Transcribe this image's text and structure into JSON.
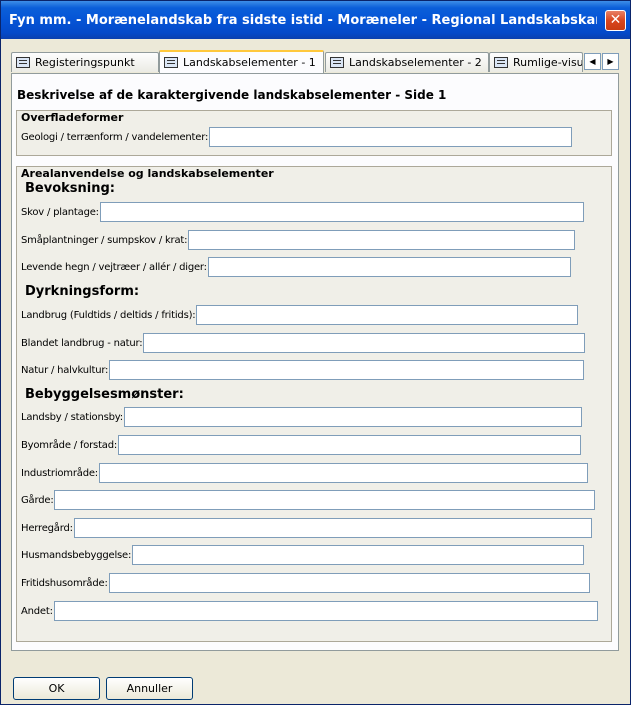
{
  "window": {
    "title": "Fyn mm. - Morænelandskab fra sidste istid - Moræneler - Regional Landskabskara...",
    "close_glyph": "✕"
  },
  "tabs": [
    {
      "label": "Registeringspunkt",
      "icon": "form-icon"
    },
    {
      "label": "Landskabselementer - 1",
      "icon": "form-icon",
      "active": true
    },
    {
      "label": "Landskabselementer - 2",
      "icon": "form-icon"
    },
    {
      "label": "Rumlige-visue",
      "icon": "form-icon"
    }
  ],
  "tab_scroll": {
    "left": "◀",
    "right": "▶"
  },
  "page": {
    "heading": "Beskrivelse af de karaktergivende landskabselementer - Side 1"
  },
  "overfladeformer": {
    "title": "Overfladeformer",
    "fields": [
      {
        "label": "Geologi / terrænform / vandelementer:",
        "value": ""
      }
    ]
  },
  "arealanvendelse": {
    "title": "Arealanvendelse og landskabselementer",
    "bevoksning": {
      "heading": "Bevoksning:",
      "fields": [
        {
          "label": "Skov / plantage:",
          "value": ""
        },
        {
          "label": "Småplantninger / sumpskov / krat:",
          "value": ""
        },
        {
          "label": "Levende hegn / vejtræer / allér / diger:",
          "value": ""
        }
      ]
    },
    "dyrkningsform": {
      "heading": "Dyrkningsform:",
      "fields": [
        {
          "label": "Landbrug (Fuldtids / deltids / fritids):",
          "value": ""
        },
        {
          "label": "Blandet landbrug - natur:",
          "value": ""
        },
        {
          "label": "Natur / halvkultur:",
          "value": ""
        }
      ]
    },
    "bebyggelse": {
      "heading": "Bebyggelsesmønster:",
      "fields": [
        {
          "label": "Landsby / stationsby:",
          "value": ""
        },
        {
          "label": "Byområde / forstad:",
          "value": ""
        },
        {
          "label": "Industriområde:",
          "value": ""
        },
        {
          "label": "Gårde:",
          "value": ""
        },
        {
          "label": "Herregård:",
          "value": ""
        },
        {
          "label": "Husmandsbebyggelse:",
          "value": ""
        },
        {
          "label": "Fritidshusområde:",
          "value": ""
        },
        {
          "label": "Andet:",
          "value": ""
        }
      ]
    }
  },
  "buttons": {
    "ok": "OK",
    "cancel": "Annuller"
  }
}
